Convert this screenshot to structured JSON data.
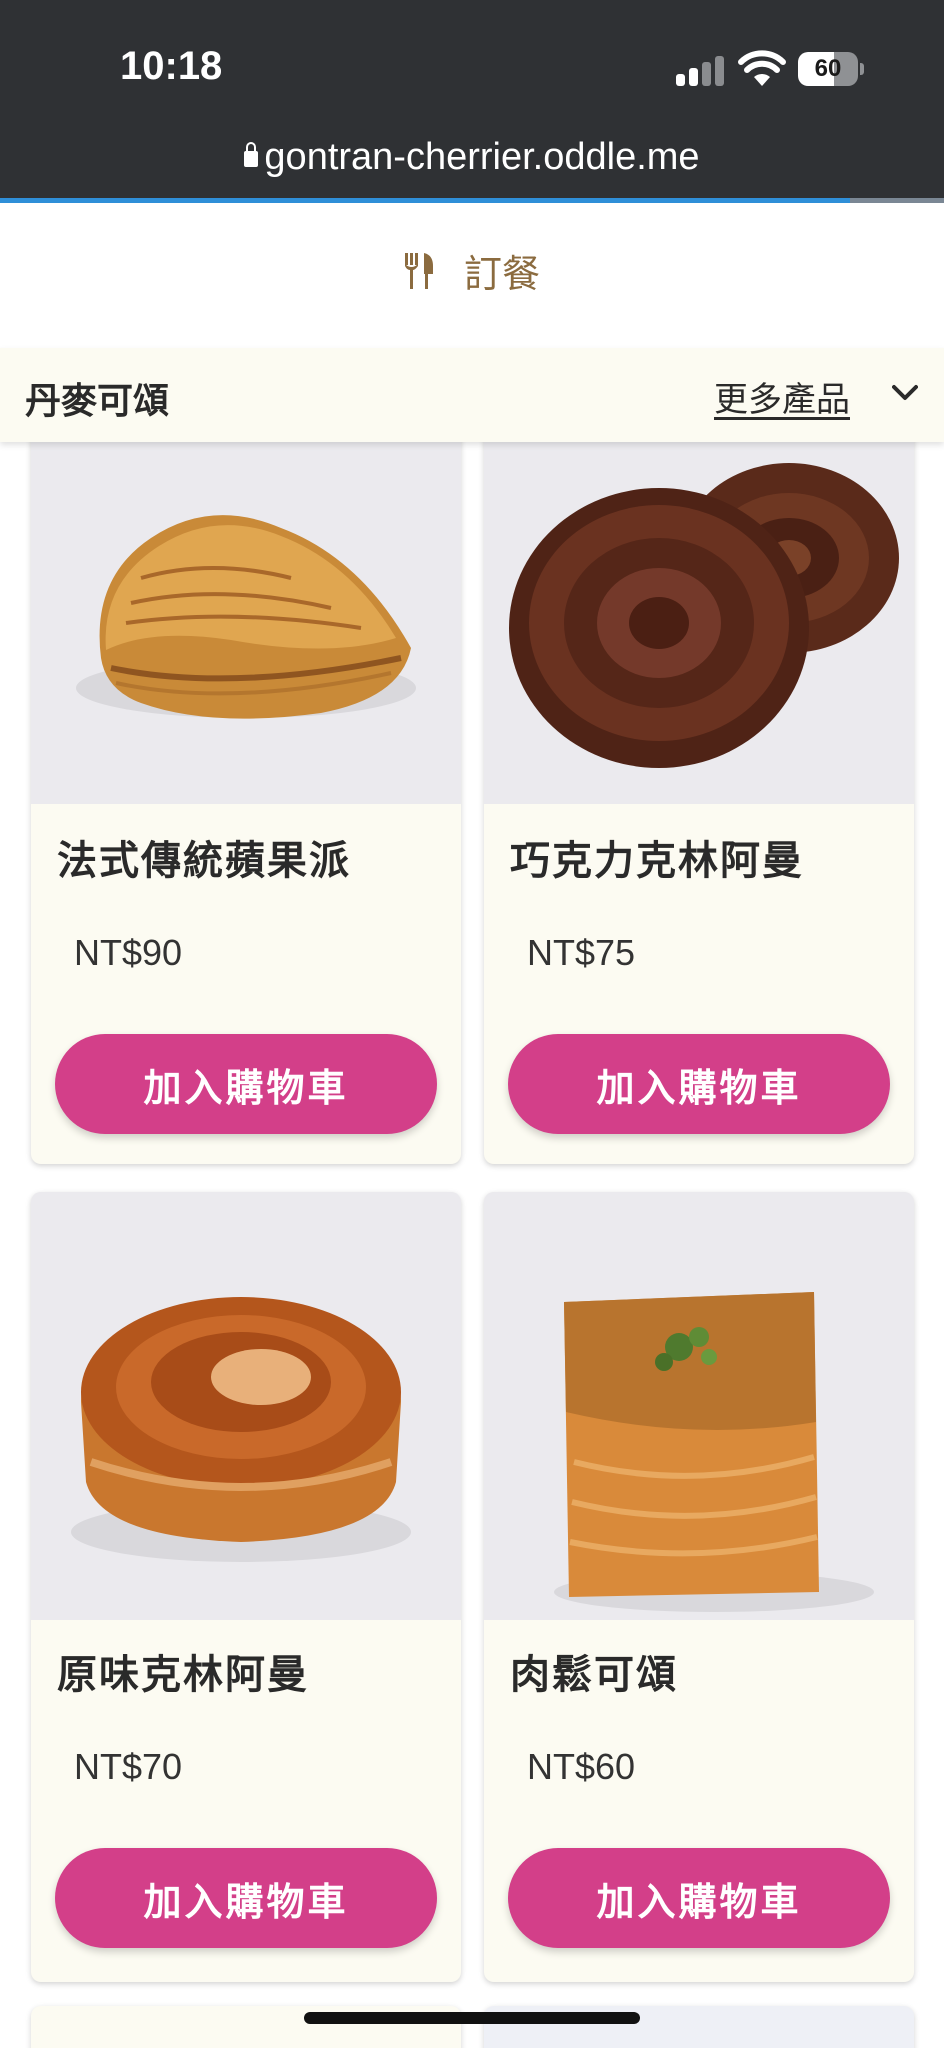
{
  "status_bar": {
    "time": "10:18",
    "battery_level": "60",
    "battery_fraction": 0.6
  },
  "browser": {
    "url": "gontran-cherrier.oddle.me",
    "load_progress": 0.9
  },
  "header": {
    "order_label": "訂餐"
  },
  "category": {
    "title": "丹麥可頌",
    "more_label": "更多產品"
  },
  "products": [
    {
      "name": "法式傳統蘋果派",
      "price": "NT$90",
      "button": "加入購物車",
      "image": "apple-turnover"
    },
    {
      "name": "巧克力克林阿曼",
      "price": "NT$75",
      "button": "加入購物車",
      "image": "chocolate-kouign-amann"
    },
    {
      "name": "原味克林阿曼",
      "price": "NT$70",
      "button": "加入購物車",
      "image": "plain-kouign-amann"
    },
    {
      "name": "肉鬆可頌",
      "price": "NT$60",
      "button": "加入購物車",
      "image": "pork-floss-croissant"
    }
  ],
  "colors": {
    "accent_button": "#d33f89",
    "order_label": "#8b6b3f",
    "card_bg": "#fcfbf2",
    "status_bg": "#2f3134"
  }
}
